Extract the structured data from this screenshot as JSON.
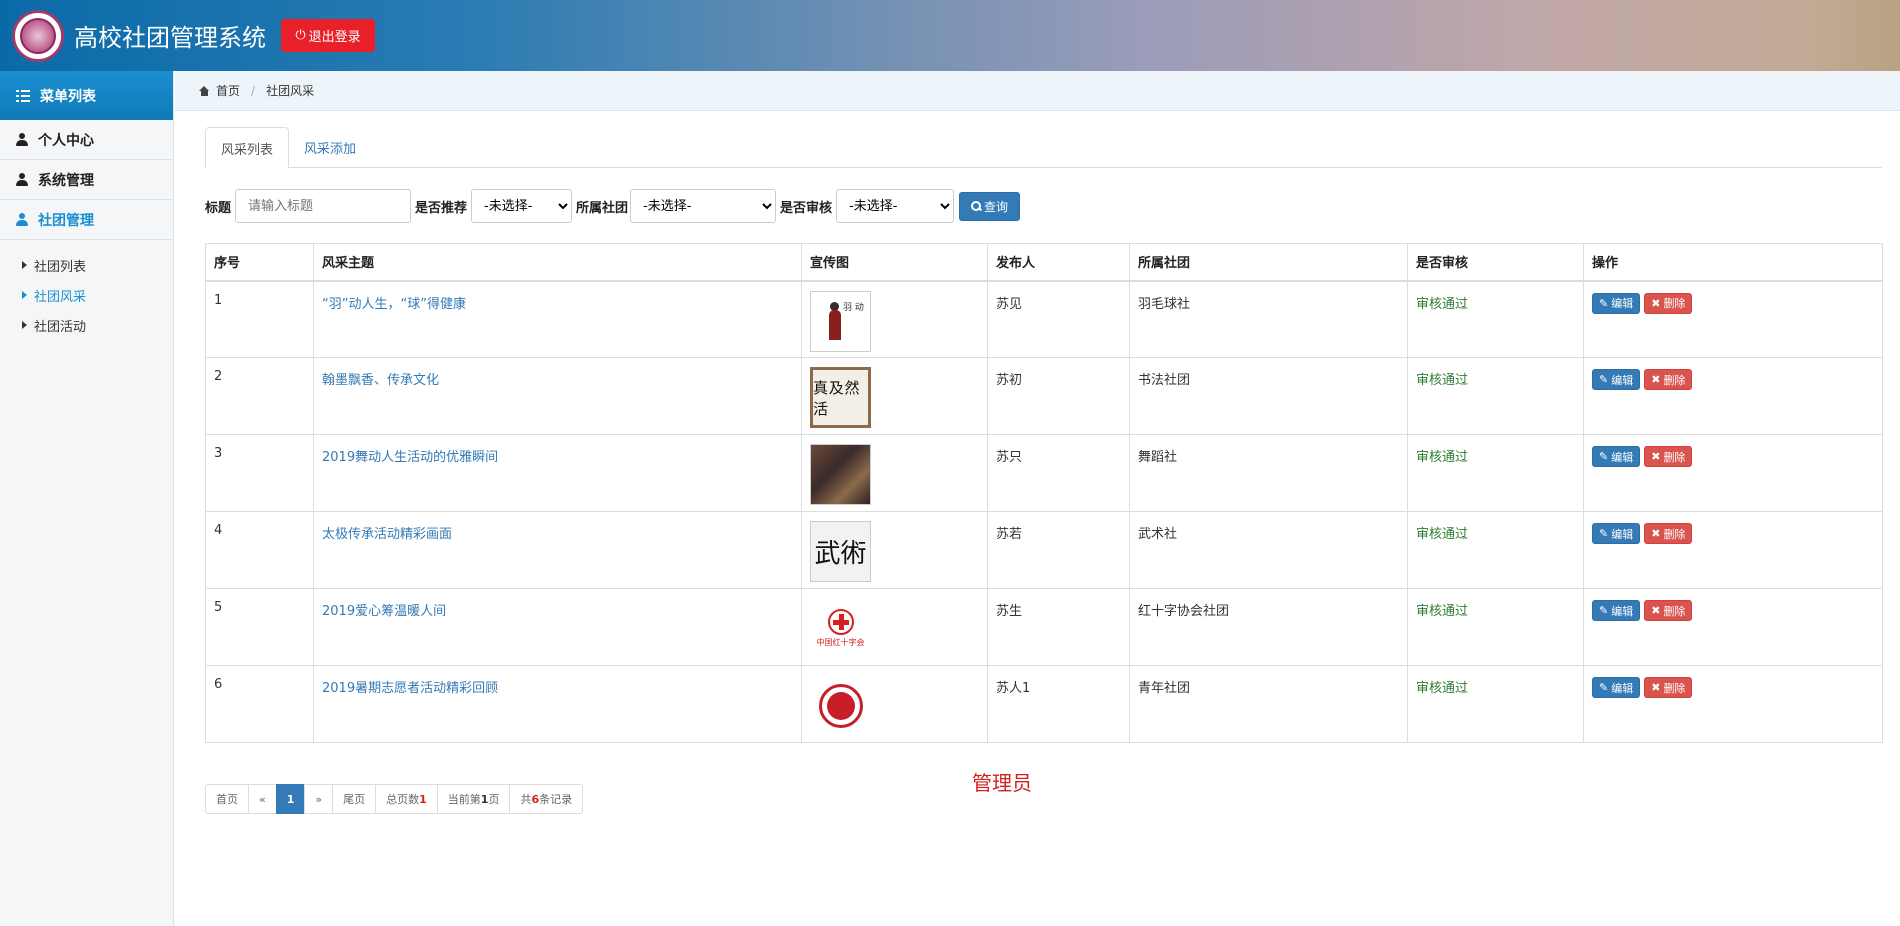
{
  "app": {
    "title": "高校社团管理系统",
    "logout_label": "退出登录"
  },
  "sidebar": {
    "header": "菜单列表",
    "items": [
      {
        "label": "个人中心",
        "active": false
      },
      {
        "label": "系统管理",
        "active": false
      },
      {
        "label": "社团管理",
        "active": true
      }
    ],
    "subitems": [
      {
        "label": "社团列表",
        "active": false
      },
      {
        "label": "社团风采",
        "active": true
      },
      {
        "label": "社团活动",
        "active": false
      }
    ]
  },
  "breadcrumb": {
    "home": "首页",
    "current": "社团风采"
  },
  "tabs": [
    {
      "label": "风采列表",
      "active": true
    },
    {
      "label": "风采添加",
      "active": false
    }
  ],
  "search": {
    "title_label": "标题",
    "title_placeholder": "请输入标题",
    "recommend_label": "是否推荐",
    "recommend_value": "-未选择-",
    "club_label": "所属社团",
    "club_value": "-未选择-",
    "audit_label": "是否审核",
    "audit_value": "-未选择-",
    "button_label": "查询"
  },
  "table": {
    "columns": [
      "序号",
      "风采主题",
      "宣传图",
      "发布人",
      "所属社团",
      "是否审核",
      "操作"
    ],
    "rows": [
      {
        "no": "1",
        "title": "“羽”动人生，“球”得健康",
        "image": "badminton-poster",
        "author": "苏见",
        "club": "羽毛球社",
        "audit": "审核通过"
      },
      {
        "no": "2",
        "title": "翰墨飘香、传承文化",
        "image": "calligraphy-scroll",
        "author": "苏初",
        "club": "书法社团",
        "audit": "审核通过"
      },
      {
        "no": "3",
        "title": "2019舞动人生活动的优雅瞬间",
        "image": "dance-photo",
        "author": "苏只",
        "club": "舞蹈社",
        "audit": "审核通过"
      },
      {
        "no": "4",
        "title": "太极传承活动精彩画面",
        "image": "wushu-calligraphy",
        "author": "苏若",
        "club": "武术社",
        "audit": "审核通过"
      },
      {
        "no": "5",
        "title": "2019爱心筹温暖人间",
        "image": "red-cross-logo",
        "author": "苏生",
        "club": "红十字协会社团",
        "audit": "审核通过"
      },
      {
        "no": "6",
        "title": "2019暑期志愿者活动精彩回顾",
        "image": "youth-league-seal",
        "author": "苏人1",
        "club": "青年社团",
        "audit": "审核通过"
      }
    ],
    "edit_label": "编辑",
    "delete_label": "删除"
  },
  "pager": {
    "first": "首页",
    "prev": "«",
    "current": "1",
    "next": "»",
    "last": "尾页",
    "total_pages_prefix": "总页数",
    "total_pages": "1",
    "current_page_prefix": "当前第",
    "current_page": "1",
    "current_page_suffix": "页",
    "records_prefix": "共",
    "records": "6",
    "records_suffix": "条记录"
  },
  "role_label": "管理员",
  "thumb_text": {
    "badminton": "羽 动",
    "calligraphy": "真 及 然 活",
    "wushu": "武術",
    "redcross": "中国红十字会"
  },
  "colors": {
    "header_start": "#0a6aa8",
    "accent": "#337ab7",
    "danger": "#d9534f",
    "logout": "#e8202a",
    "pass": "#2e7d32"
  }
}
